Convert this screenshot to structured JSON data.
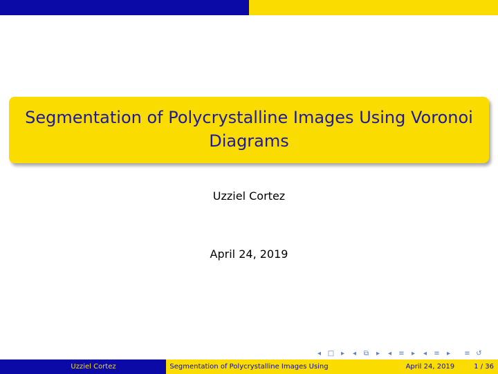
{
  "slide": {
    "title": "Segmentation of Polycrystalline Images Using Voronoi Diagrams",
    "author": "Uzziel Cortez",
    "date": "April 24, 2019"
  },
  "footer": {
    "author": "Uzziel Cortez",
    "short_title": "Segmentation of Polycrystalline Images Using",
    "date": "April 24, 2019",
    "page": "1 / 36"
  },
  "nav": {
    "icons": [
      "frame-prev-icon",
      "frame-icon",
      "frame-next-icon",
      "subsection-prev-icon",
      "subsection-icon",
      "subsection-next-icon",
      "section-prev-icon",
      "section-icon",
      "section-next-icon",
      "doc-prev-icon",
      "doc-icon",
      "doc-next-icon",
      "align-icon",
      "search-icon"
    ]
  },
  "colors": {
    "primary_blue": "#0c0aa6",
    "accent_yellow": "#fbdc00"
  }
}
